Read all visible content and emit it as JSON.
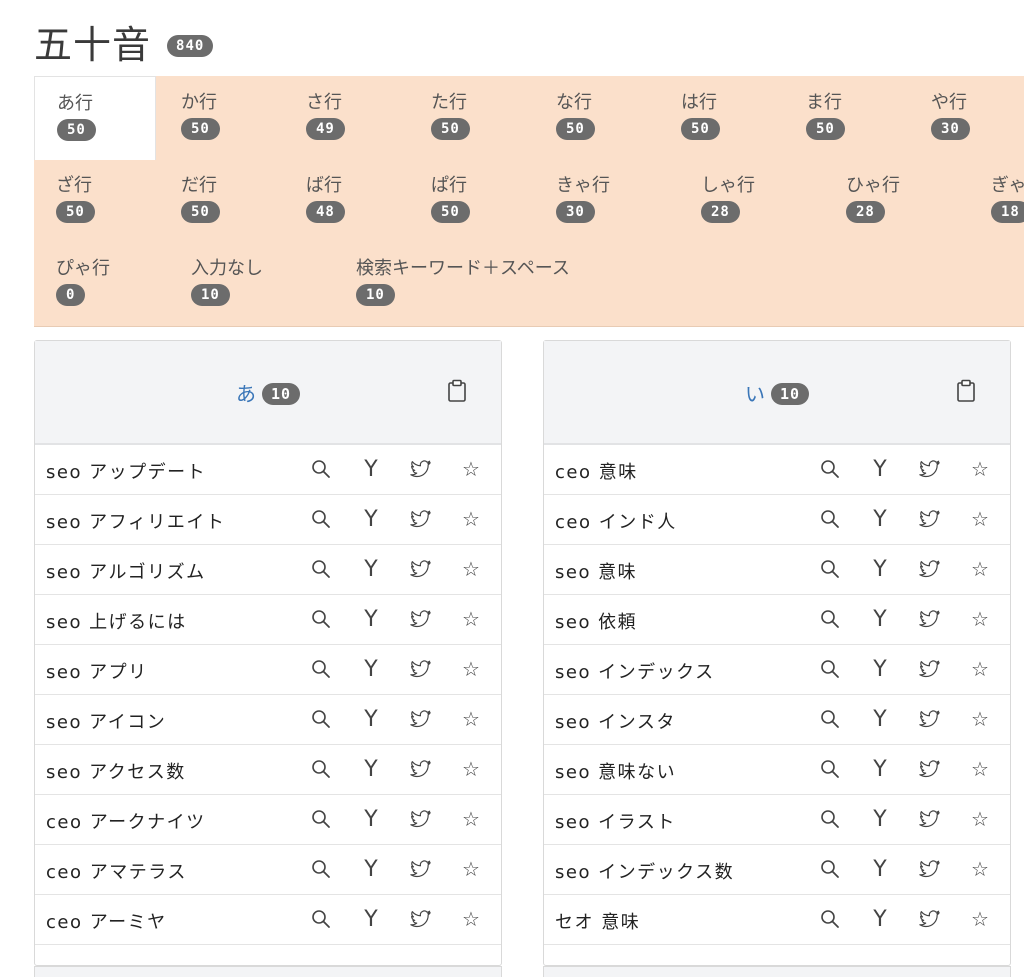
{
  "header": {
    "title": "五十音",
    "count": "840"
  },
  "tabs": [
    {
      "label": "あ行",
      "count": "50",
      "active": true
    },
    {
      "label": "か行",
      "count": "50"
    },
    {
      "label": "さ行",
      "count": "49"
    },
    {
      "label": "た行",
      "count": "50"
    },
    {
      "label": "な行",
      "count": "50"
    },
    {
      "label": "は行",
      "count": "50"
    },
    {
      "label": "ま行",
      "count": "50"
    },
    {
      "label": "や行",
      "count": "30"
    },
    {
      "label": "ざ行",
      "count": "50"
    },
    {
      "label": "だ行",
      "count": "50"
    },
    {
      "label": "ば行",
      "count": "48"
    },
    {
      "label": "ぱ行",
      "count": "50"
    },
    {
      "label": "きゃ行",
      "count": "30"
    },
    {
      "label": "しゃ行",
      "count": "28"
    },
    {
      "label": "ひゃ行",
      "count": "28"
    },
    {
      "label": "ぎゃ",
      "count": "18"
    },
    {
      "label": "ぴゃ行",
      "count": "0"
    },
    {
      "label": "入力なし",
      "count": "10"
    },
    {
      "label": "検索キーワード＋スペース",
      "count": "10"
    }
  ],
  "cards": [
    {
      "kana": "あ",
      "count": "10",
      "rows": [
        "seo アップデート",
        "seo アフィリエイト",
        "seo アルゴリズム",
        "seo 上げるには",
        "seo アプリ",
        "seo アイコン",
        "seo アクセス数",
        "ceo アークナイツ",
        "ceo アマテラス",
        "ceo アーミヤ"
      ]
    },
    {
      "kana": "い",
      "count": "10",
      "rows": [
        "ceo 意味",
        "ceo インド人",
        "seo 意味",
        "seo 依頼",
        "seo インデックス",
        "seo インスタ",
        "seo 意味ない",
        "seo イラスト",
        "seo インデックス数",
        "セオ 意味"
      ]
    }
  ],
  "icons": {
    "search": "search-icon",
    "yahoo": "Y",
    "twitter": "twitter-icon",
    "star": "☆",
    "clipboard": "clipboard-icon"
  }
}
